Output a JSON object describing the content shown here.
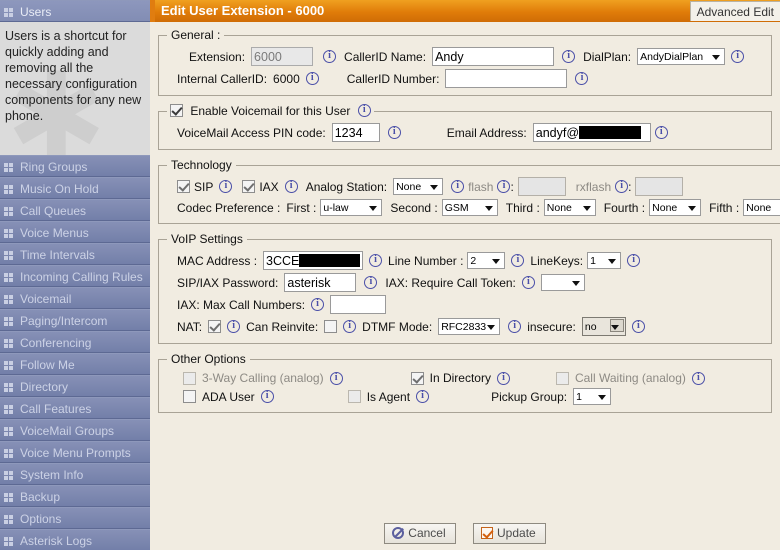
{
  "sidebar": {
    "active_item": "Users",
    "description": "Users is a shortcut for quickly adding and removing all the necessary configuration components for any new phone.",
    "items": [
      {
        "label": "Users"
      },
      {
        "label": "Ring Groups"
      },
      {
        "label": "Music On Hold"
      },
      {
        "label": "Call Queues"
      },
      {
        "label": "Voice Menus"
      },
      {
        "label": "Time Intervals"
      },
      {
        "label": "Incoming Calling Rules"
      },
      {
        "label": "Voicemail"
      },
      {
        "label": "Paging/Intercom"
      },
      {
        "label": "Conferencing"
      },
      {
        "label": "Follow Me"
      },
      {
        "label": "Directory"
      },
      {
        "label": "Call Features"
      },
      {
        "label": "VoiceMail Groups"
      },
      {
        "label": "Voice Menu Prompts"
      },
      {
        "label": "System Info"
      },
      {
        "label": "Backup"
      },
      {
        "label": "Options"
      },
      {
        "label": "Asterisk Logs"
      }
    ]
  },
  "header": {
    "title": "Edit User Extension - 6000",
    "advanced_tab": "Advanced Edit"
  },
  "general": {
    "legend": "General :",
    "extension_label": "Extension:",
    "extension_value": "6000",
    "callerid_name_label": "CallerID Name:",
    "callerid_name_value": "Andy",
    "dialplan_label": "DialPlan:",
    "dialplan_value": "AndyDialPlan",
    "internal_callerid_label": "Internal CallerID:",
    "internal_callerid_value": "6000",
    "callerid_number_label": "CallerID Number:",
    "callerid_number_value": ""
  },
  "voicemail": {
    "enable_label": "Enable Voicemail for this User",
    "enable_checked": true,
    "pin_label": "VoiceMail Access PIN code:",
    "pin_value": "1234",
    "email_label": "Email Address:",
    "email_value": "andyf@"
  },
  "technology": {
    "legend": "Technology",
    "sip_label": "SIP",
    "sip_checked": true,
    "iax_label": "IAX",
    "iax_checked": true,
    "analog_station_label": "Analog Station:",
    "analog_station_value": "None",
    "flash_label": "flash",
    "flash_value": "",
    "rxflash_label": "rxflash",
    "rxflash_value": "",
    "codec_pref_label": "Codec Preference :",
    "first_label": "First :",
    "first_value": "u-law",
    "second_label": "Second :",
    "second_value": "GSM",
    "third_label": "Third :",
    "third_value": "None",
    "fourth_label": "Fourth :",
    "fourth_value": "None",
    "fifth_label": "Fifth :",
    "fifth_value": "None"
  },
  "voip": {
    "legend": "VoIP Settings",
    "mac_label": "MAC Address :",
    "mac_value": "3CCE",
    "line_number_label": "Line Number :",
    "line_number_value": "2",
    "linekeys_label": "LineKeys:",
    "linekeys_value": "1",
    "password_label": "SIP/IAX Password:",
    "password_value": "asterisk",
    "call_token_label": "IAX: Require Call Token:",
    "call_token_value": "",
    "max_call_label": "IAX: Max Call Numbers:",
    "max_call_value": "",
    "nat_label": "NAT:",
    "nat_checked": true,
    "can_reinvite_label": "Can Reinvite:",
    "can_reinvite_checked": false,
    "dtmf_label": "DTMF Mode:",
    "dtmf_value": "RFC2833",
    "insecure_label": "insecure:",
    "insecure_value": "no"
  },
  "other": {
    "legend": "Other Options",
    "three_way_label": "3-Way Calling (analog)",
    "three_way_checked": false,
    "in_directory_label": "In Directory",
    "in_directory_checked": true,
    "call_waiting_label": "Call Waiting (analog)",
    "call_waiting_checked": false,
    "ada_user_label": "ADA User",
    "ada_user_checked": false,
    "is_agent_label": "Is Agent",
    "is_agent_checked": false,
    "pickup_group_label": "Pickup Group:",
    "pickup_group_value": "1"
  },
  "footer": {
    "cancel_label": "Cancel",
    "update_label": "Update"
  },
  "colors": {
    "header_orange": "#e07c09",
    "sidebar_blue": "#7b86ae",
    "page_bg": "#f1ece1",
    "info_icon": "#4a4fa8"
  }
}
